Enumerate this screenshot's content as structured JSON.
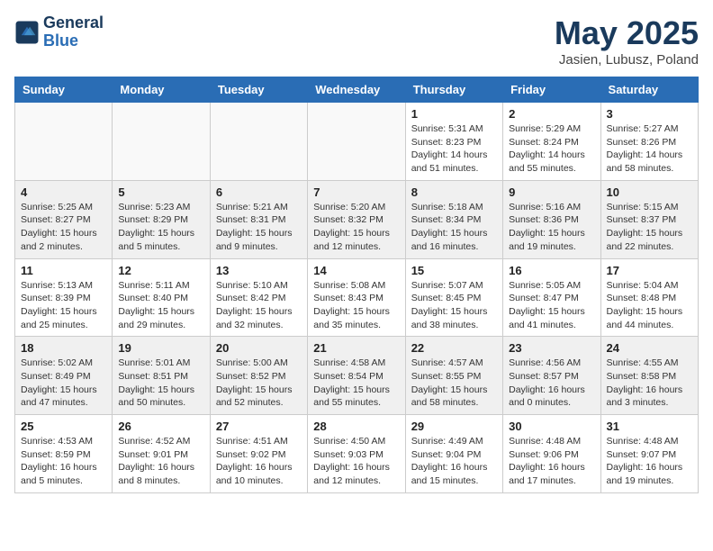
{
  "header": {
    "logo_line1": "General",
    "logo_line2": "Blue",
    "month": "May 2025",
    "location": "Jasien, Lubusz, Poland"
  },
  "weekdays": [
    "Sunday",
    "Monday",
    "Tuesday",
    "Wednesday",
    "Thursday",
    "Friday",
    "Saturday"
  ],
  "weeks": [
    [
      {
        "day": "",
        "info": ""
      },
      {
        "day": "",
        "info": ""
      },
      {
        "day": "",
        "info": ""
      },
      {
        "day": "",
        "info": ""
      },
      {
        "day": "1",
        "info": "Sunrise: 5:31 AM\nSunset: 8:23 PM\nDaylight: 14 hours\nand 51 minutes."
      },
      {
        "day": "2",
        "info": "Sunrise: 5:29 AM\nSunset: 8:24 PM\nDaylight: 14 hours\nand 55 minutes."
      },
      {
        "day": "3",
        "info": "Sunrise: 5:27 AM\nSunset: 8:26 PM\nDaylight: 14 hours\nand 58 minutes."
      }
    ],
    [
      {
        "day": "4",
        "info": "Sunrise: 5:25 AM\nSunset: 8:27 PM\nDaylight: 15 hours\nand 2 minutes."
      },
      {
        "day": "5",
        "info": "Sunrise: 5:23 AM\nSunset: 8:29 PM\nDaylight: 15 hours\nand 5 minutes."
      },
      {
        "day": "6",
        "info": "Sunrise: 5:21 AM\nSunset: 8:31 PM\nDaylight: 15 hours\nand 9 minutes."
      },
      {
        "day": "7",
        "info": "Sunrise: 5:20 AM\nSunset: 8:32 PM\nDaylight: 15 hours\nand 12 minutes."
      },
      {
        "day": "8",
        "info": "Sunrise: 5:18 AM\nSunset: 8:34 PM\nDaylight: 15 hours\nand 16 minutes."
      },
      {
        "day": "9",
        "info": "Sunrise: 5:16 AM\nSunset: 8:36 PM\nDaylight: 15 hours\nand 19 minutes."
      },
      {
        "day": "10",
        "info": "Sunrise: 5:15 AM\nSunset: 8:37 PM\nDaylight: 15 hours\nand 22 minutes."
      }
    ],
    [
      {
        "day": "11",
        "info": "Sunrise: 5:13 AM\nSunset: 8:39 PM\nDaylight: 15 hours\nand 25 minutes."
      },
      {
        "day": "12",
        "info": "Sunrise: 5:11 AM\nSunset: 8:40 PM\nDaylight: 15 hours\nand 29 minutes."
      },
      {
        "day": "13",
        "info": "Sunrise: 5:10 AM\nSunset: 8:42 PM\nDaylight: 15 hours\nand 32 minutes."
      },
      {
        "day": "14",
        "info": "Sunrise: 5:08 AM\nSunset: 8:43 PM\nDaylight: 15 hours\nand 35 minutes."
      },
      {
        "day": "15",
        "info": "Sunrise: 5:07 AM\nSunset: 8:45 PM\nDaylight: 15 hours\nand 38 minutes."
      },
      {
        "day": "16",
        "info": "Sunrise: 5:05 AM\nSunset: 8:47 PM\nDaylight: 15 hours\nand 41 minutes."
      },
      {
        "day": "17",
        "info": "Sunrise: 5:04 AM\nSunset: 8:48 PM\nDaylight: 15 hours\nand 44 minutes."
      }
    ],
    [
      {
        "day": "18",
        "info": "Sunrise: 5:02 AM\nSunset: 8:49 PM\nDaylight: 15 hours\nand 47 minutes."
      },
      {
        "day": "19",
        "info": "Sunrise: 5:01 AM\nSunset: 8:51 PM\nDaylight: 15 hours\nand 50 minutes."
      },
      {
        "day": "20",
        "info": "Sunrise: 5:00 AM\nSunset: 8:52 PM\nDaylight: 15 hours\nand 52 minutes."
      },
      {
        "day": "21",
        "info": "Sunrise: 4:58 AM\nSunset: 8:54 PM\nDaylight: 15 hours\nand 55 minutes."
      },
      {
        "day": "22",
        "info": "Sunrise: 4:57 AM\nSunset: 8:55 PM\nDaylight: 15 hours\nand 58 minutes."
      },
      {
        "day": "23",
        "info": "Sunrise: 4:56 AM\nSunset: 8:57 PM\nDaylight: 16 hours\nand 0 minutes."
      },
      {
        "day": "24",
        "info": "Sunrise: 4:55 AM\nSunset: 8:58 PM\nDaylight: 16 hours\nand 3 minutes."
      }
    ],
    [
      {
        "day": "25",
        "info": "Sunrise: 4:53 AM\nSunset: 8:59 PM\nDaylight: 16 hours\nand 5 minutes."
      },
      {
        "day": "26",
        "info": "Sunrise: 4:52 AM\nSunset: 9:01 PM\nDaylight: 16 hours\nand 8 minutes."
      },
      {
        "day": "27",
        "info": "Sunrise: 4:51 AM\nSunset: 9:02 PM\nDaylight: 16 hours\nand 10 minutes."
      },
      {
        "day": "28",
        "info": "Sunrise: 4:50 AM\nSunset: 9:03 PM\nDaylight: 16 hours\nand 12 minutes."
      },
      {
        "day": "29",
        "info": "Sunrise: 4:49 AM\nSunset: 9:04 PM\nDaylight: 16 hours\nand 15 minutes."
      },
      {
        "day": "30",
        "info": "Sunrise: 4:48 AM\nSunset: 9:06 PM\nDaylight: 16 hours\nand 17 minutes."
      },
      {
        "day": "31",
        "info": "Sunrise: 4:48 AM\nSunset: 9:07 PM\nDaylight: 16 hours\nand 19 minutes."
      }
    ]
  ]
}
